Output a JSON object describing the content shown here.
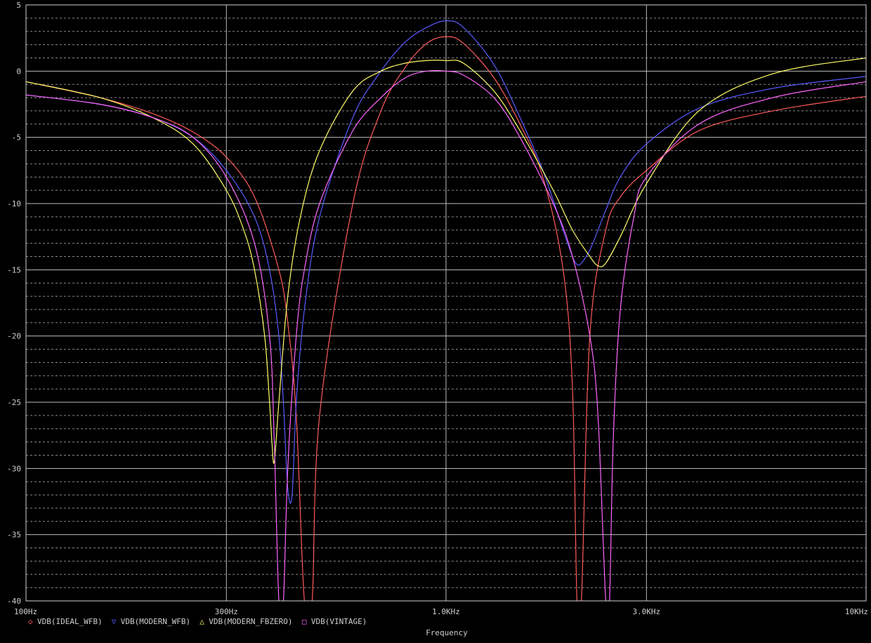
{
  "chart_data": {
    "type": "line",
    "xlabel": "Frequency",
    "ylabel": "",
    "xscale": "log",
    "xlim": [
      100,
      10000
    ],
    "ylim": [
      -40,
      5
    ],
    "grid": true,
    "legend_position": "bottom-left",
    "x_ticks": [
      {
        "value": 100,
        "label": "100Hz"
      },
      {
        "value": 300,
        "label": "300Hz"
      },
      {
        "value": 1000,
        "label": "1.0KHz"
      },
      {
        "value": 3000,
        "label": "3.0KHz"
      },
      {
        "value": 10000,
        "label": "10KHz"
      }
    ],
    "y_ticks": [
      {
        "value": 5,
        "label": "5"
      },
      {
        "value": 0,
        "label": "0"
      },
      {
        "value": -5,
        "label": "-5"
      },
      {
        "value": -10,
        "label": "-10"
      },
      {
        "value": -15,
        "label": "-15"
      },
      {
        "value": -20,
        "label": "-20"
      },
      {
        "value": -25,
        "label": "-25"
      },
      {
        "value": -30,
        "label": "-30"
      },
      {
        "value": -35,
        "label": "-35"
      },
      {
        "value": -40,
        "label": "-40"
      }
    ],
    "series": [
      {
        "name": "VDB(IDEAL_WFB)",
        "color": "#ff5a5a",
        "marker": "◇",
        "x": [
          100,
          150,
          200,
          250,
          300,
          350,
          400,
          420,
          440,
          460,
          480,
          500,
          600,
          700,
          800,
          900,
          1000,
          1100,
          1300,
          1500,
          1700,
          1900,
          2000,
          2050,
          2100,
          2200,
          2400,
          2600,
          3000,
          4000,
          6000,
          10000
        ],
        "y": [
          -0.8,
          -2.0,
          -3.2,
          -4.6,
          -6.5,
          -9.5,
          -15.0,
          -19.0,
          -26.0,
          -40.0,
          -40.0,
          -26.0,
          -10.0,
          -3.0,
          0.3,
          2.1,
          2.6,
          2.1,
          -0.5,
          -4.0,
          -8.0,
          -15.0,
          -24.0,
          -40.0,
          -40.0,
          -20.0,
          -12.0,
          -9.5,
          -7.5,
          -4.5,
          -3.0,
          -1.9
        ]
      },
      {
        "name": "VDB(MODERN_WFB)",
        "color": "#5a5aff",
        "marker": "▽",
        "x": [
          100,
          150,
          200,
          250,
          300,
          350,
          380,
          400,
          410,
          420,
          430,
          440,
          460,
          500,
          600,
          700,
          800,
          900,
          1000,
          1100,
          1300,
          1500,
          1700,
          1900,
          2000,
          2050,
          2100,
          2200,
          2300,
          2400,
          2600,
          3000,
          4000,
          6000,
          10000
        ],
        "y": [
          -1.8,
          -2.5,
          -3.5,
          -5.0,
          -7.5,
          -11.0,
          -15.0,
          -20.0,
          -25.0,
          -31.5,
          -32.0,
          -25.0,
          -18.0,
          -11.0,
          -3.5,
          0.0,
          2.2,
          3.3,
          3.8,
          3.3,
          0.5,
          -3.5,
          -7.5,
          -12.0,
          -14.0,
          -14.6,
          -14.5,
          -13.5,
          -12.0,
          -10.5,
          -8.0,
          -5.5,
          -2.8,
          -1.3,
          -0.4
        ]
      },
      {
        "name": "VDB(MODERN_FBZERO)",
        "color": "#ffff66",
        "marker": "△",
        "x": [
          100,
          150,
          200,
          250,
          300,
          330,
          350,
          370,
          380,
          385,
          390,
          400,
          420,
          450,
          500,
          600,
          700,
          800,
          900,
          1000,
          1100,
          1300,
          1500,
          1800,
          2000,
          2200,
          2300,
          2400,
          2600,
          3000,
          4000,
          6000,
          10000
        ],
        "y": [
          -0.8,
          -2.0,
          -3.5,
          -5.5,
          -9.0,
          -12.0,
          -15.0,
          -20.0,
          -25.0,
          -28.0,
          -29.5,
          -25.0,
          -17.0,
          -11.0,
          -6.0,
          -1.5,
          0.0,
          0.6,
          0.8,
          0.8,
          0.6,
          -1.5,
          -4.5,
          -9.0,
          -12.0,
          -14.0,
          -14.7,
          -14.5,
          -12.5,
          -8.5,
          -3.0,
          -0.2,
          1.0
        ]
      },
      {
        "name": "VDB(VINTAGE)",
        "color": "#ff66ff",
        "marker": "□",
        "x": [
          100,
          150,
          200,
          250,
          300,
          350,
          380,
          390,
          400,
          410,
          420,
          440,
          460,
          500,
          600,
          700,
          800,
          900,
          1000,
          1100,
          1300,
          1500,
          1800,
          2000,
          2200,
          2300,
          2400,
          2450,
          2500,
          2600,
          2800,
          3000,
          4000,
          6000,
          10000
        ],
        "y": [
          -1.8,
          -2.5,
          -3.5,
          -5.0,
          -8.0,
          -13.0,
          -20.0,
          -28.0,
          -40.0,
          -40.0,
          -30.0,
          -20.0,
          -15.0,
          -10.0,
          -4.5,
          -2.0,
          -0.5,
          0.0,
          0.0,
          -0.3,
          -2.0,
          -5.0,
          -10.0,
          -14.0,
          -20.0,
          -26.0,
          -40.0,
          -40.0,
          -28.0,
          -18.0,
          -11.0,
          -8.0,
          -4.0,
          -2.0,
          -0.8
        ]
      }
    ]
  }
}
